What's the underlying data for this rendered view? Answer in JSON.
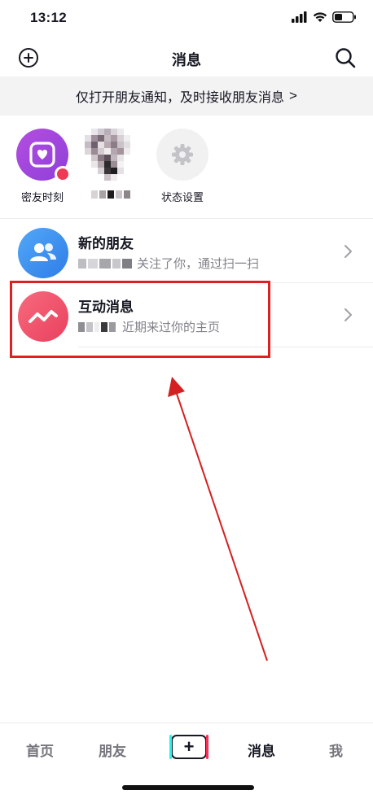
{
  "status_bar": {
    "time": "13:12"
  },
  "nav": {
    "title": "消息"
  },
  "banner": {
    "text": "仅打开朋友通知，及时接收朋友消息",
    "chevron": ">"
  },
  "friends_row": {
    "items": [
      {
        "label": "密友时刻",
        "icon": "heart-photo-icon"
      },
      {
        "label": "",
        "icon": "blurred-avatar"
      },
      {
        "label": "状态设置",
        "icon": "gear-icon"
      }
    ]
  },
  "messages": [
    {
      "title": "新的朋友",
      "subtitle": "关注了你，通过扫一扫",
      "icon": "users-icon",
      "color": "#3d8ef0"
    },
    {
      "title": "互动消息",
      "subtitle": "近期来过你的主页",
      "icon": "zigzag-icon",
      "color": "#f24e6b"
    }
  ],
  "tabbar": {
    "tabs": [
      {
        "label": "首页"
      },
      {
        "label": "朋友"
      },
      {
        "label": "+"
      },
      {
        "label": "消息"
      },
      {
        "label": "我"
      }
    ],
    "active": "消息"
  },
  "annotation": {
    "highlight_color": "#e02020",
    "arrow_color": "#d42020"
  }
}
